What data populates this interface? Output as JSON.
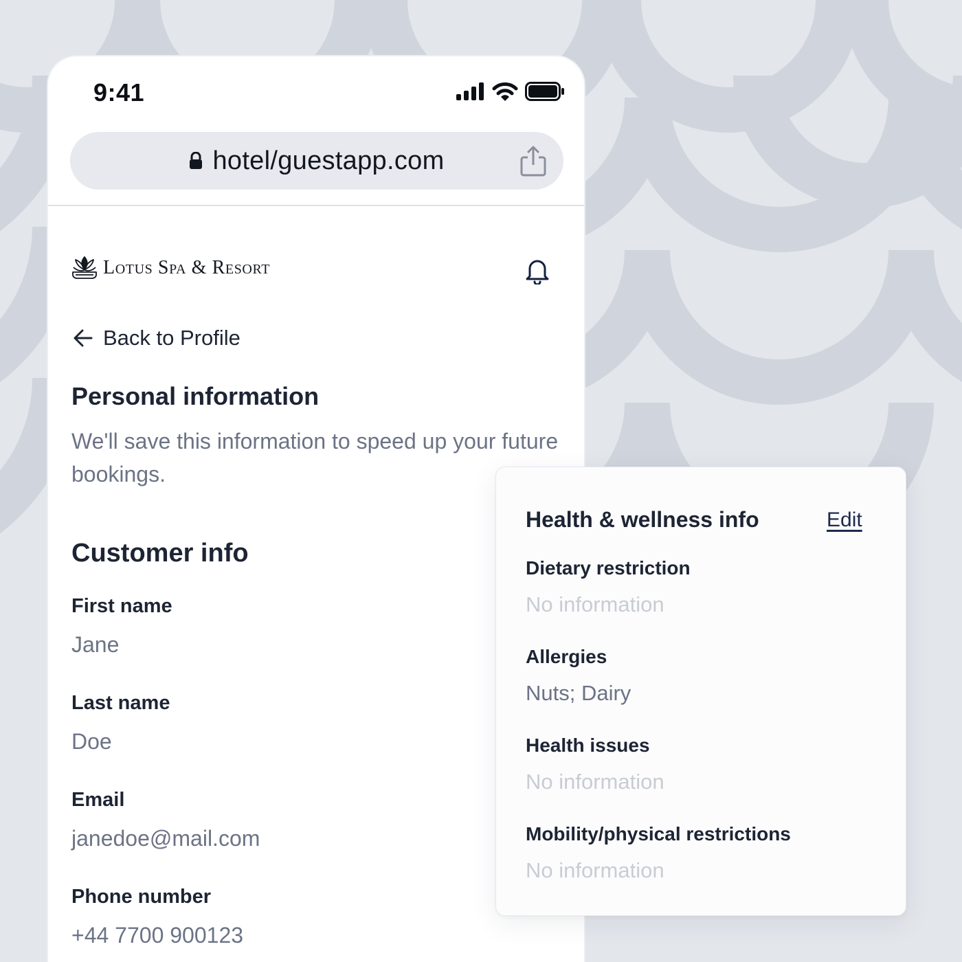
{
  "status_bar": {
    "time": "9:41"
  },
  "browser": {
    "url": "hotel/guestapp.com"
  },
  "brand": {
    "name": "Lotus Spa & Resort"
  },
  "nav": {
    "back_label": "Back to Profile"
  },
  "personal": {
    "title": "Personal information",
    "description": "We'll save this information to speed up your future bookings."
  },
  "customer": {
    "title": "Customer info",
    "fields": [
      {
        "label": "First name",
        "value": "Jane"
      },
      {
        "label": "Last name",
        "value": "Doe"
      },
      {
        "label": "Email",
        "value": "janedoe@mail.com"
      },
      {
        "label": "Phone number",
        "value": "+44 7700 900123"
      }
    ]
  },
  "health": {
    "title": "Health & wellness info",
    "edit_label": "Edit",
    "fields": [
      {
        "label": "Dietary restriction",
        "value": "No information"
      },
      {
        "label": "Allergies",
        "value": "Nuts; Dairy"
      },
      {
        "label": "Health issues",
        "value": "No information"
      },
      {
        "label": "Mobility/physical restrictions",
        "value": "No information"
      }
    ]
  },
  "colors": {
    "background": "#e3e6eb",
    "pattern": "#d0d4dc",
    "text_primary": "#1d2433",
    "text_secondary": "#6b7385",
    "text_placeholder": "#c9ccd3",
    "link": "#1d2a4d"
  },
  "icons": [
    "signal-icon",
    "wifi-icon",
    "battery-icon",
    "lock-icon",
    "share-icon",
    "lotus-logo-icon",
    "bell-icon",
    "arrow-left-icon"
  ]
}
